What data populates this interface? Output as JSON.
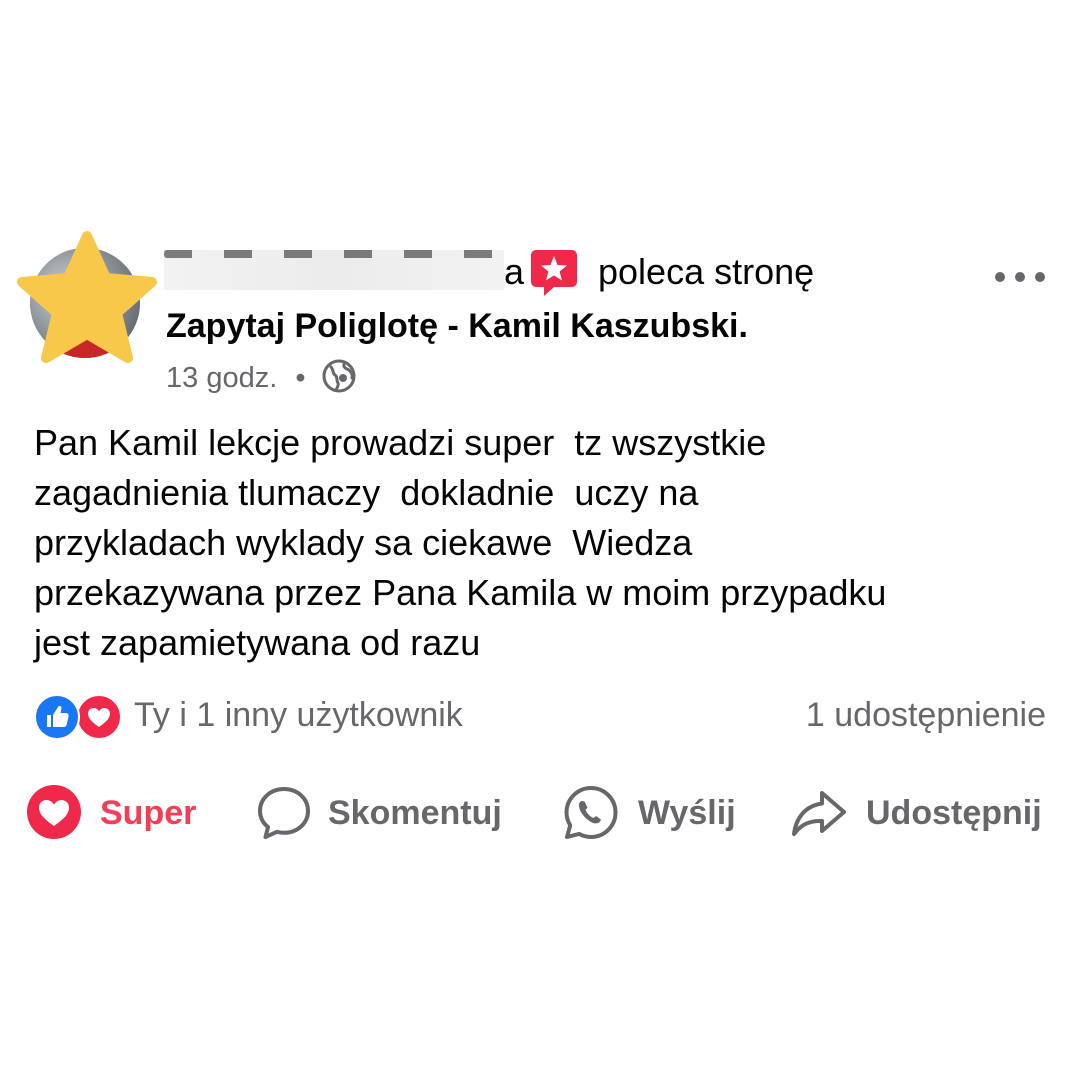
{
  "post": {
    "author_name_visible_tail": "a",
    "recommends_text": "poleca stronę",
    "page_name": "Zapytaj Poliglotę - Kamil Kaszubski.",
    "time": "13 godz.",
    "meta_separator": "•",
    "audience_icon": "globe-icon",
    "text": "Pan Kamil lekcje prowadzi super  tz wszystkie\nzagadnienia tlumaczy  dokladnie  uczy na\nprzykladach wyklady sa ciekawe  Wiedza\nprzekazywana przez Pana Kamila w moim przypadku\njest zapamietywana od razu"
  },
  "reactions": {
    "icons": [
      "like-icon",
      "love-icon"
    ],
    "summary": "Ty i 1 inny użytkownik",
    "shares": "1 udostępnienie"
  },
  "actions": {
    "super": "Super",
    "comment": "Skomentuj",
    "send": "Wyślij",
    "share": "Udostępnij"
  },
  "colors": {
    "text": "#050505",
    "secondary": "#65676b",
    "like_blue": "#1877f2",
    "love_red": "#f33e58",
    "star_overlay": "#f8c84a"
  }
}
